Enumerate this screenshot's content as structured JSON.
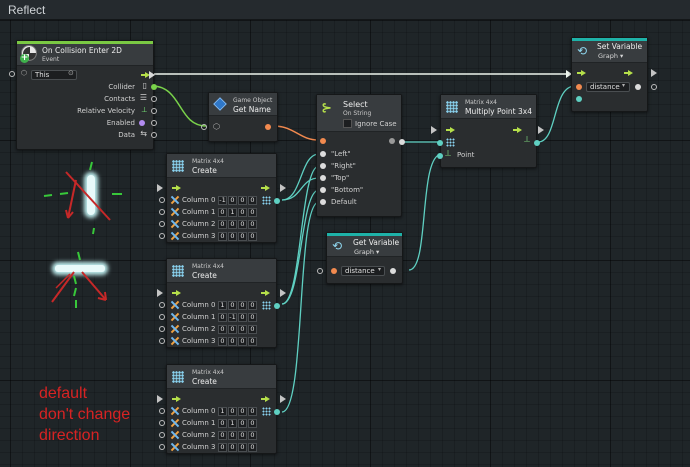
{
  "window": {
    "title": "Reflect"
  },
  "colors": {
    "flow": "#b6e04a",
    "object": "#f28a4f",
    "matrix": "#5fd0c2",
    "bool": "#b38cf0",
    "variable_strip": "#1eb2a8",
    "event_strip": "#7ac943",
    "annotation": "#d72323"
  },
  "icons": {
    "collision": "collision-icon",
    "cube": "cube-icon",
    "select": "select-fork-icon",
    "matrix": "matrix-grid-icon",
    "variable": "variable-graph-icon",
    "axes": "axes-icon"
  },
  "nodes": {
    "collision": {
      "title": "On Collision Enter 2D",
      "subtitle": "Event",
      "target": "This",
      "outputs": [
        "Collider",
        "Contacts",
        "Relative Velocity",
        "Enabled",
        "Data"
      ]
    },
    "getname": {
      "title": "Game Object",
      "subtitle": "Get Name"
    },
    "select": {
      "title": "Select",
      "subtitle": "On String",
      "ignore_case": "Ignore Case",
      "options": [
        "\"Left\"",
        "\"Right\"",
        "\"Top\"",
        "\"Bottom\"",
        "Default"
      ]
    },
    "multiply": {
      "title": "Matrix 4x4",
      "subtitle": "Multiply Point 3x4",
      "input": "Point"
    },
    "setvar": {
      "title": "Set Variable",
      "scope": "Graph ▾",
      "name": "distance"
    },
    "getvar": {
      "title": "Get Variable",
      "scope": "Graph ▾",
      "name": "distance"
    },
    "matrices": [
      {
        "title": "Matrix 4x4",
        "subtitle": "Create",
        "columns": [
          {
            "label": "Column 0",
            "values": [
              "-1",
              "0",
              "0",
              "0"
            ]
          },
          {
            "label": "Column 1",
            "values": [
              "0",
              "1",
              "0",
              "0"
            ]
          },
          {
            "label": "Column 2",
            "values": [
              "0",
              "0",
              "0",
              "0"
            ]
          },
          {
            "label": "Column 3",
            "values": [
              "0",
              "0",
              "0",
              "0"
            ]
          }
        ]
      },
      {
        "title": "Matrix 4x4",
        "subtitle": "Create",
        "columns": [
          {
            "label": "Column 0",
            "values": [
              "1",
              "0",
              "0",
              "0"
            ]
          },
          {
            "label": "Column 1",
            "values": [
              "0",
              "-1",
              "0",
              "0"
            ]
          },
          {
            "label": "Column 2",
            "values": [
              "0",
              "0",
              "0",
              "0"
            ]
          },
          {
            "label": "Column 3",
            "values": [
              "0",
              "0",
              "0",
              "0"
            ]
          }
        ]
      },
      {
        "title": "Matrix 4x4",
        "subtitle": "Create",
        "columns": [
          {
            "label": "Column 0",
            "values": [
              "1",
              "0",
              "0",
              "0"
            ]
          },
          {
            "label": "Column 1",
            "values": [
              "0",
              "1",
              "0",
              "0"
            ]
          },
          {
            "label": "Column 2",
            "values": [
              "0",
              "0",
              "0",
              "0"
            ]
          },
          {
            "label": "Column 3",
            "values": [
              "0",
              "0",
              "0",
              "0"
            ]
          }
        ]
      }
    ]
  },
  "annotation": "default\ndon't change\ndirection"
}
